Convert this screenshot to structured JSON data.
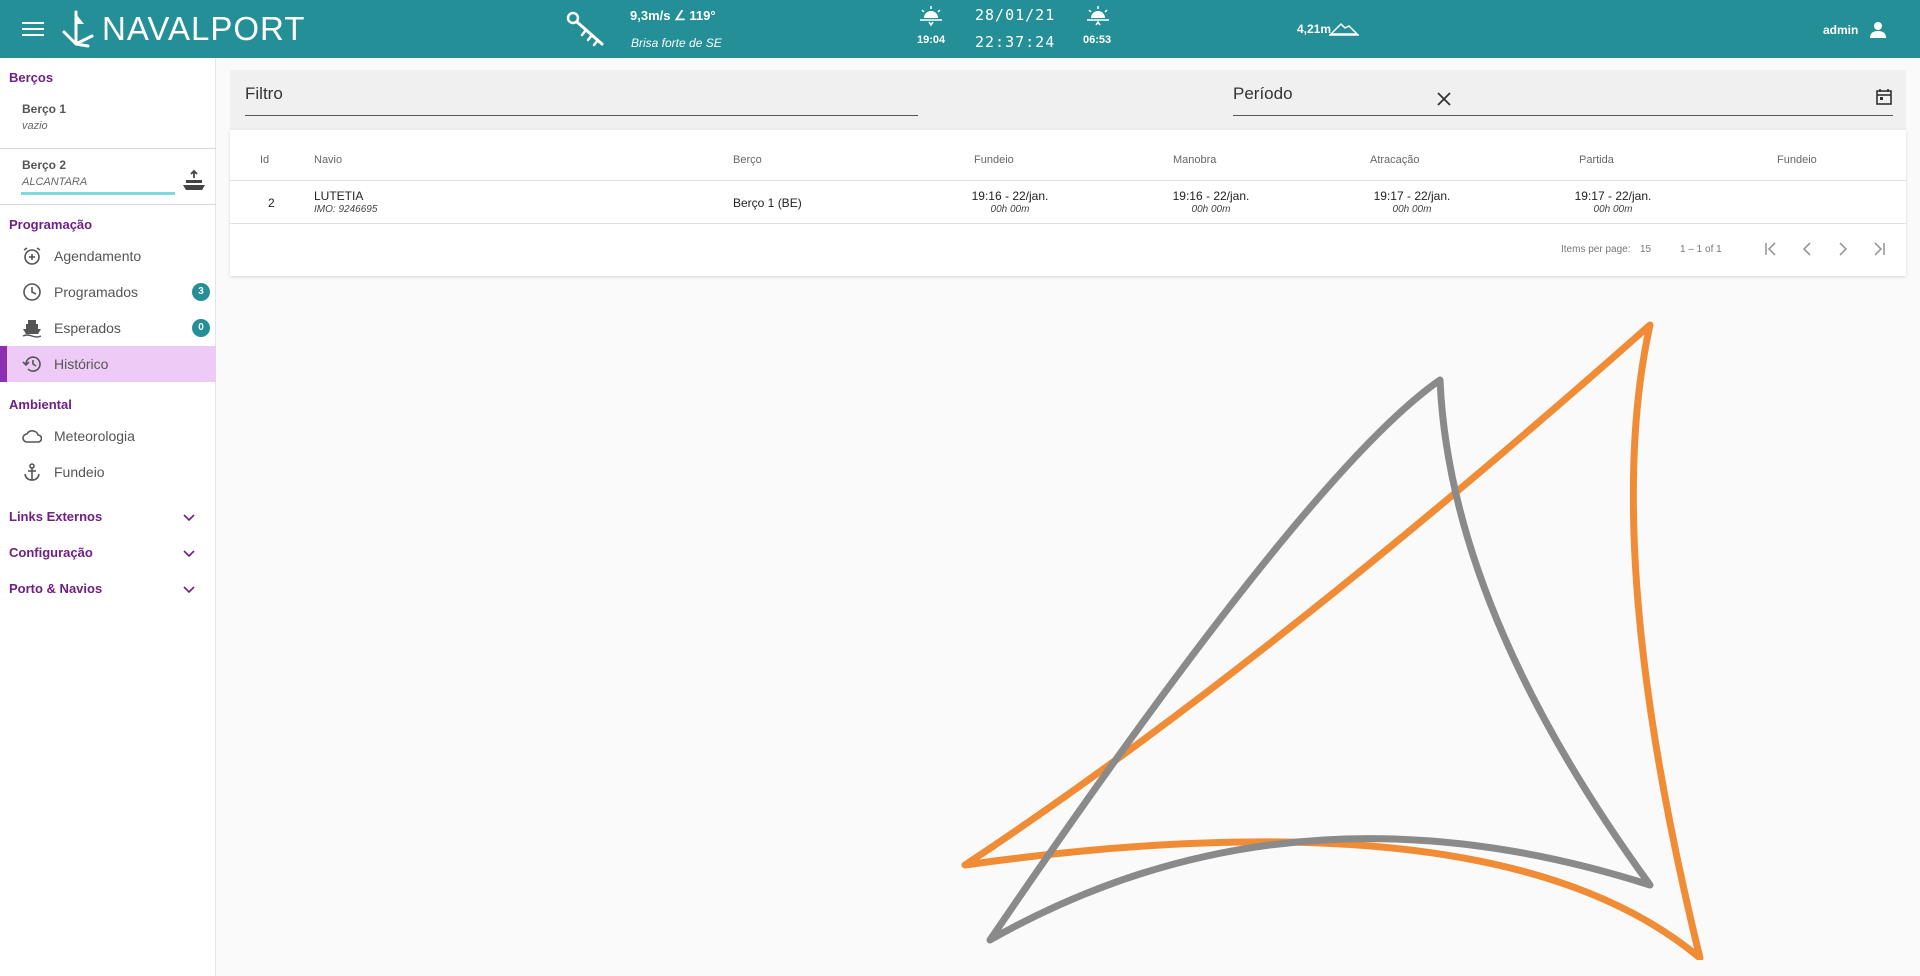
{
  "header": {
    "brand": "NAVALPORT",
    "wind_speed": "9,3m/s ∠ 119°",
    "wind_desc": "Brisa forte de SE",
    "sunset_time": "19:04",
    "date": "28/01/21",
    "clock": "22:37:24",
    "sunrise_time": "06:53",
    "tide": "4,21m",
    "user": "admin",
    "brand_color": "#248f96"
  },
  "sidebar": {
    "bercos_title": "Berços",
    "berths": [
      {
        "name": "Berço 1",
        "status": "vazio"
      },
      {
        "name": "Berço 2",
        "status": "ALCANTARA"
      }
    ],
    "programacao_title": "Programação",
    "programacao_items": [
      {
        "label": "Agendamento",
        "icon": "alarm-add-icon"
      },
      {
        "label": "Programados",
        "icon": "clock-icon",
        "badge": "3"
      },
      {
        "label": "Esperados",
        "icon": "ship-icon",
        "badge": "0"
      },
      {
        "label": "Histórico",
        "icon": "history-icon",
        "active": true
      }
    ],
    "ambiental_title": "Ambiental",
    "ambiental_items": [
      {
        "label": "Meteorologia",
        "icon": "cloud-icon"
      },
      {
        "label": "Fundeio",
        "icon": "anchor-icon"
      }
    ],
    "collapsibles": [
      "Links Externos",
      "Configuração",
      "Porto & Navios"
    ],
    "accent_color": "#6f1f85"
  },
  "filters": {
    "filtro_placeholder": "Filtro",
    "periodo_placeholder": "Período"
  },
  "table": {
    "columns": [
      "Id",
      "Navio",
      "Berço",
      "Fundeio",
      "Manobra",
      "Atracação",
      "Partida",
      "Fundeio"
    ],
    "rows": [
      {
        "id": "2",
        "navio": "LUTETIA",
        "imo": "IMO: 9246695",
        "berco": "Berço 1 (BE)",
        "fundeio": "19:16 - 22/jan.",
        "fundeio_dur": "00h 00m",
        "manobra": "19:16 - 22/jan.",
        "manobra_dur": "00h 00m",
        "atracacao": "19:17 - 22/jan.",
        "atracacao_dur": "00h 00m",
        "partida": "19:17 - 22/jan.",
        "partida_dur": "00h 00m",
        "fundeio2": ""
      }
    ],
    "pager": {
      "items_per_page_label": "Items per page:",
      "items_per_page": "15",
      "range": "1 – 1 of 1"
    }
  }
}
